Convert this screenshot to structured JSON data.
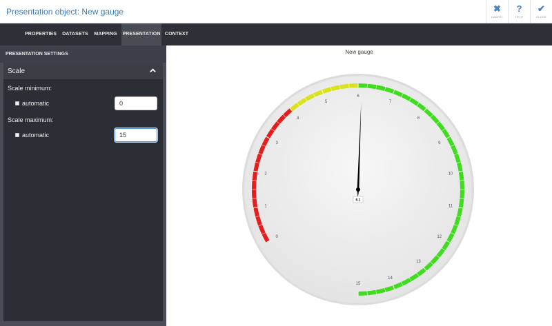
{
  "window": {
    "title": "Presentation object: New gauge",
    "actions": [
      {
        "label": "CANCEL",
        "icon": "close-icon",
        "glyph": "✖"
      },
      {
        "label": "HELP",
        "icon": "help-icon",
        "glyph": "?"
      },
      {
        "label": "CLOSE",
        "icon": "check-icon",
        "glyph": "✔"
      }
    ]
  },
  "tabs": [
    {
      "label": "PROPERTIES",
      "active": false
    },
    {
      "label": "DATASETS",
      "active": false
    },
    {
      "label": "MAPPING",
      "active": false
    },
    {
      "label": "PRESENTATION",
      "active": true
    },
    {
      "label": "CONTEXT",
      "active": false
    }
  ],
  "settings": {
    "header": "PRESENTATION SETTINGS",
    "section": {
      "title": "Scale",
      "expanded": true,
      "scale_minimum_label": "Scale minimum:",
      "scale_minimum_auto_label": "automatic",
      "scale_minimum_auto_checked": false,
      "scale_minimum_value": "0",
      "scale_maximum_label": "Scale maximum:",
      "scale_maximum_auto_label": "automatic",
      "scale_maximum_auto_checked": false,
      "scale_maximum_value": "15"
    }
  },
  "gauge": {
    "title": "New gauge",
    "min": 0,
    "max": 15,
    "value": 6.1,
    "value_label": "6.1",
    "ticks": [
      "0",
      "1",
      "2",
      "3",
      "4",
      "5",
      "6",
      "7",
      "8",
      "9",
      "10",
      "11",
      "12",
      "13",
      "14",
      "15"
    ],
    "bands": [
      {
        "from": 0,
        "to": 4,
        "color": "#e41e1e"
      },
      {
        "from": 4,
        "to": 6,
        "color": "#d9e21b"
      },
      {
        "from": 6,
        "to": 15,
        "color": "#3fdc1f"
      }
    ],
    "face_color": "#eeeeee",
    "needle_color": "#000000"
  }
}
